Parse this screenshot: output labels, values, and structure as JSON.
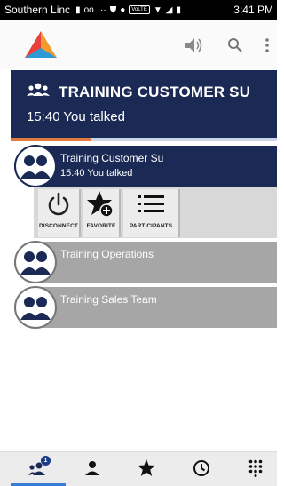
{
  "status_bar": {
    "carrier": "Southern Linc",
    "time": "3:41 PM",
    "volte_label": "VoLTE"
  },
  "header": {
    "title": "TRAINING CUSTOMER SU",
    "subtitle": "15:40 You talked",
    "progress_fraction": 0.3
  },
  "conversations": [
    {
      "name": "Training Customer Su",
      "last_activity": "15:40 You talked",
      "active": true
    },
    {
      "name": "Training Operations",
      "last_activity": "",
      "active": false
    },
    {
      "name": "Training Sales Team",
      "last_activity": "",
      "active": false
    }
  ],
  "actions": {
    "disconnect": "DISCONNECT",
    "favorite": "FAVORITE",
    "participants": "PARTICIPANTS"
  },
  "bottom_nav": {
    "groups_badge": "1"
  },
  "colors": {
    "navy": "#1b2a55",
    "accent_orange": "#e07a3f",
    "inactive_gray": "#a6a6a6"
  }
}
